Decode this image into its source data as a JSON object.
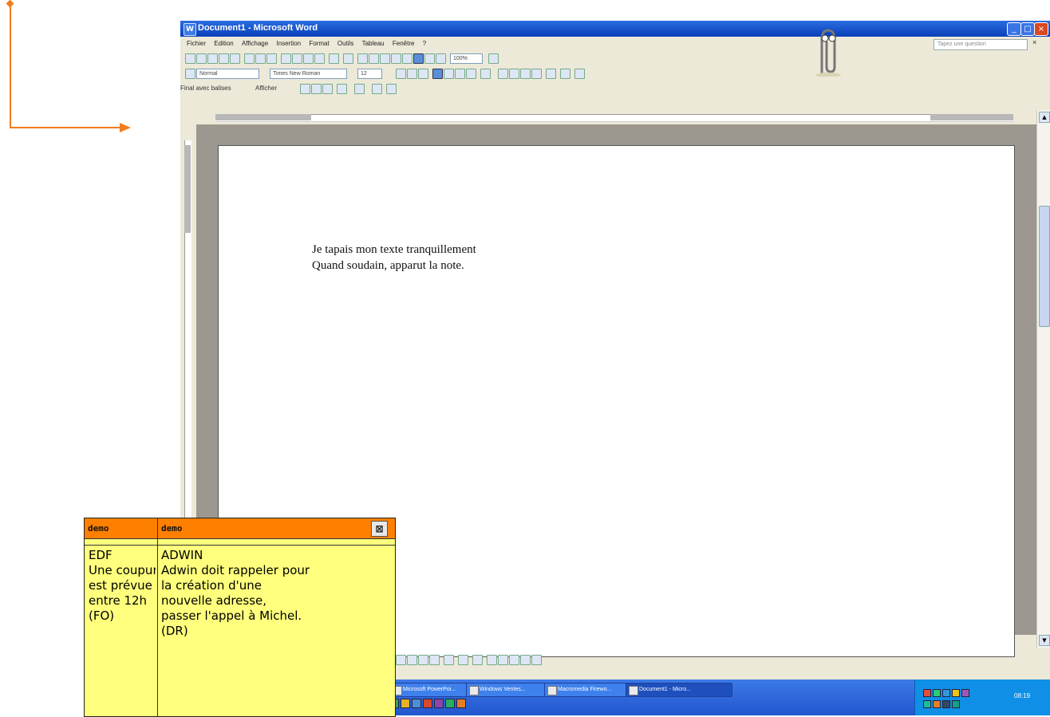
{
  "window": {
    "title": "Document1 - Microsoft Word"
  },
  "menu": {
    "items": [
      "Fichier",
      "Edition",
      "Affichage",
      "Insertion",
      "Format",
      "Outils",
      "Tableau",
      "Fenêtre",
      "?"
    ],
    "help_placeholder": "Tapez une question"
  },
  "toolbar": {
    "zoom": "100%",
    "style": "Normal",
    "font": "Times New Roman",
    "size": "12",
    "review_label": "Final avec balises",
    "show_label": "Afficher"
  },
  "document": {
    "lines": [
      "Je tapais mon texte tranquillement",
      "Quand soudain, apparut la note."
    ]
  },
  "taskbar": {
    "items": [
      "Microsoft PowerPoi...",
      "Windows Ventes...",
      "Macromedia Firewo...",
      "Document1 - Micro..."
    ],
    "clock": "08:19"
  },
  "note": {
    "header_left": "demo",
    "header_right": "demo",
    "close_glyph": "⊠",
    "col1_lines": [
      "EDF",
      "Une coupure",
      "est prévue",
      "entre 12h",
      "(FO)"
    ],
    "col2_lines": [
      "ADWIN",
      "Adwin doit rappeler pour",
      "la création d'une",
      "nouvelle adresse,",
      "passer l'appel à Michel.",
      "(DR)"
    ]
  },
  "colors": {
    "annotation": "#f27d1c",
    "note_header": "#ff8000",
    "note_body": "#ffff7d",
    "title_bar": "#0a3fb8",
    "taskbar": "#2256cf"
  }
}
